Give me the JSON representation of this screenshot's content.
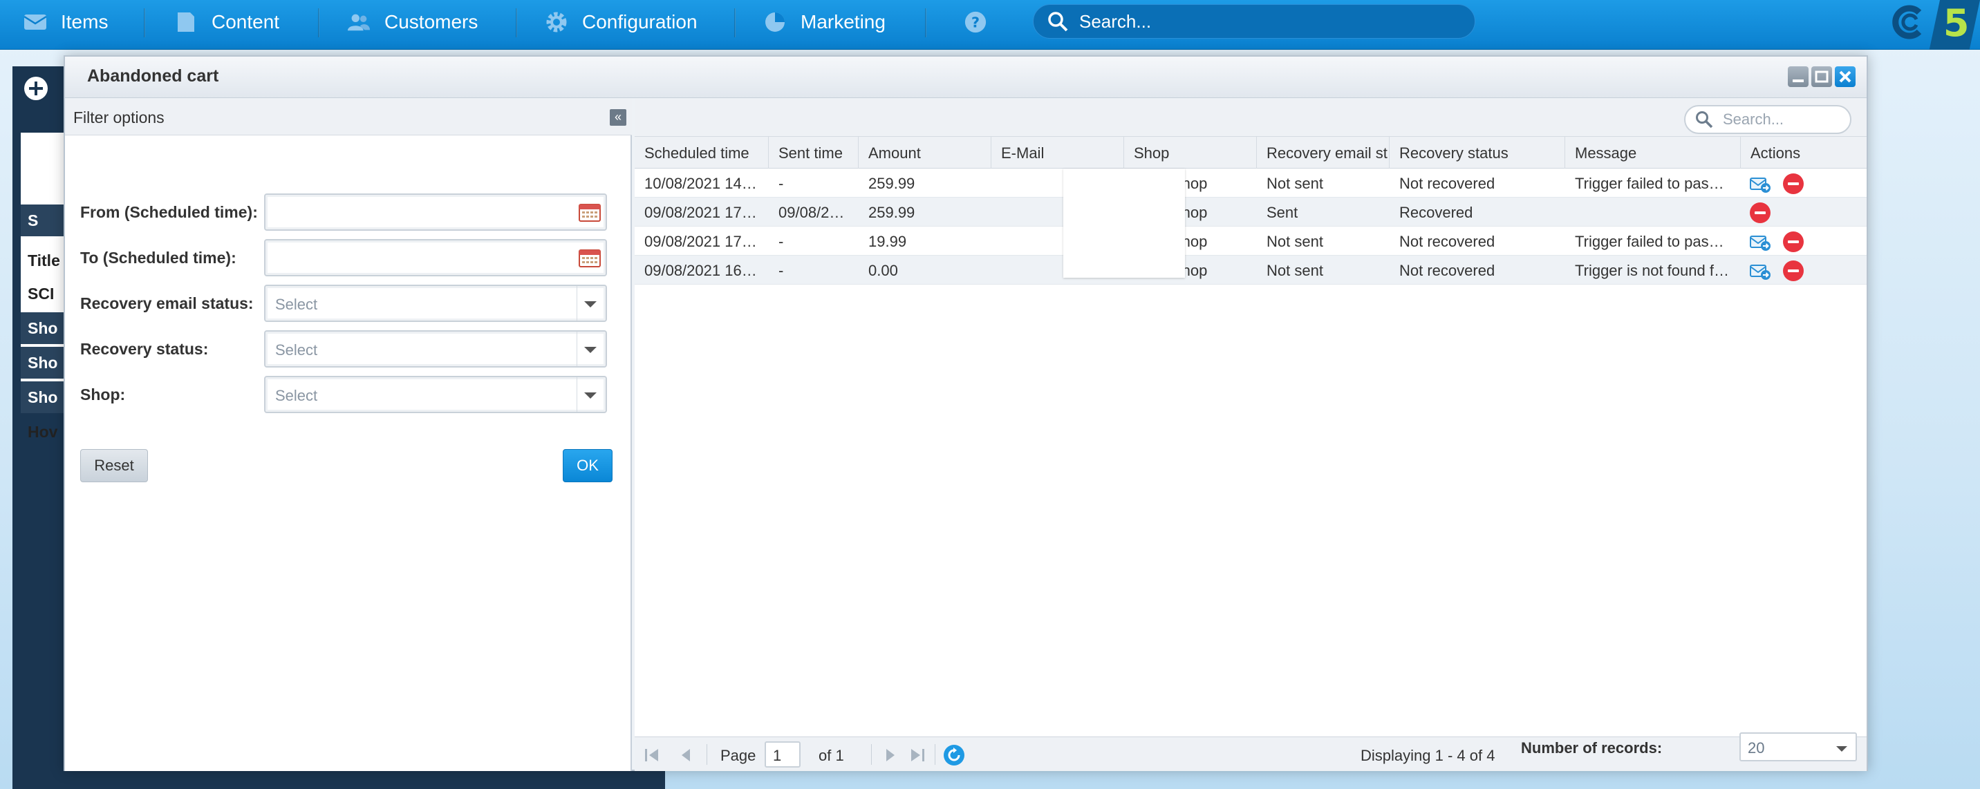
{
  "topnav": {
    "items": [
      {
        "label": "Items",
        "icon": "envelope-icon"
      },
      {
        "label": "Content",
        "icon": "document-icon"
      },
      {
        "label": "Customers",
        "icon": "users-icon"
      },
      {
        "label": "Configuration",
        "icon": "gear-icon"
      },
      {
        "label": "Marketing",
        "icon": "pie-chart-icon"
      }
    ],
    "help_icon": "help-icon",
    "search_placeholder": "Search...",
    "brand_letter": "5"
  },
  "background": {
    "rows": [
      "S",
      "Title",
      "SCI",
      "Sho",
      "Sho",
      "Sho",
      "Hov"
    ]
  },
  "window": {
    "title": "Abandoned cart"
  },
  "filter": {
    "title": "Filter options",
    "collapse_glyph": "«",
    "fields": {
      "from_label": "From (Scheduled time):",
      "to_label": "To (Scheduled time):",
      "email_status_label": "Recovery email status:",
      "email_status_placeholder": "Select",
      "recovery_status_label": "Recovery status:",
      "recovery_status_placeholder": "Select",
      "shop_label": "Shop:",
      "shop_placeholder": "Select"
    },
    "reset_label": "Reset",
    "ok_label": "OK"
  },
  "grid": {
    "search_placeholder": "Search...",
    "columns": [
      "Scheduled time",
      "Sent time",
      "Amount",
      "E-Mail",
      "Shop",
      "Recovery email st",
      "Recovery status",
      "Message",
      "Actions"
    ],
    "rows": [
      {
        "scheduled": "10/08/2021 14:…",
        "sent": "-",
        "amount": "259.99",
        "email": "",
        "shop": "Demoshop",
        "email_status": "Not sent",
        "status": "Not recovered",
        "message": "Trigger failed to pass…",
        "resend": true
      },
      {
        "scheduled": "09/08/2021 17:…",
        "sent": "09/08/2…",
        "amount": "259.99",
        "email": "",
        "shop": "Demoshop",
        "email_status": "Sent",
        "status": "Recovered",
        "message": "",
        "resend": false
      },
      {
        "scheduled": "09/08/2021 17:…",
        "sent": "-",
        "amount": "19.99",
        "email": "",
        "shop": "Demoshop",
        "email_status": "Not sent",
        "status": "Not recovered",
        "message": "Trigger failed to pass…",
        "resend": true
      },
      {
        "scheduled": "09/08/2021 16:…",
        "sent": "-",
        "amount": "0.00",
        "email": "",
        "shop": "Demoshop",
        "email_status": "Not sent",
        "status": "Not recovered",
        "message": "Trigger is not found f…",
        "resend": true
      }
    ],
    "pager": {
      "page_label": "Page",
      "page_value": "1",
      "of_label": "of 1",
      "displaying": "Displaying 1 - 4 of 4",
      "records_label": "Number of records:",
      "records_value": "20"
    }
  },
  "colors": {
    "accent": "#0a87d6",
    "delete": "#e8343f",
    "brand": "#b7e34a"
  }
}
